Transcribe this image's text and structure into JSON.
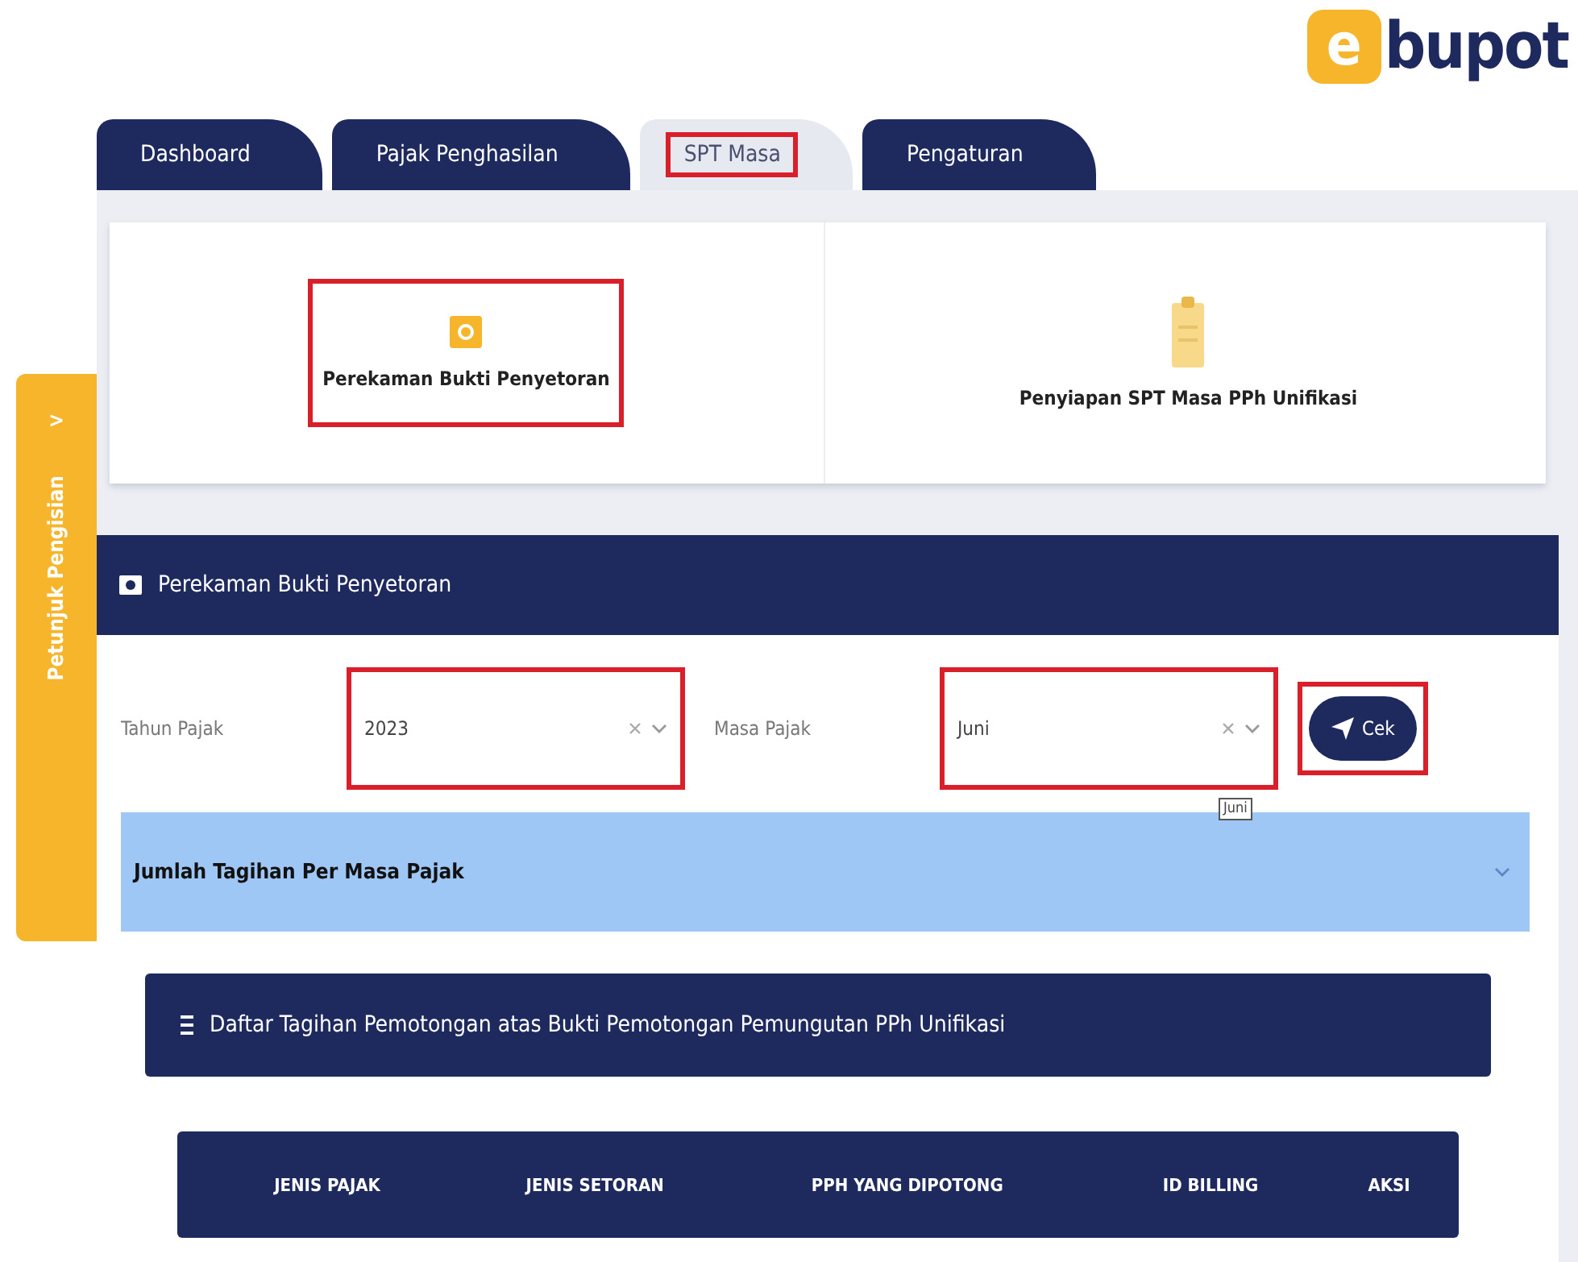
{
  "logo": {
    "letter": "e",
    "name": "bupot"
  },
  "tabs": [
    {
      "label": "Dashboard",
      "selected": false,
      "highlighted": false
    },
    {
      "label": "Pajak Penghasilan",
      "selected": false,
      "highlighted": false
    },
    {
      "label": "SPT Masa",
      "selected": true,
      "highlighted": true
    },
    {
      "label": "Pengaturan",
      "selected": false,
      "highlighted": false
    }
  ],
  "side_tab": {
    "label": "Petunjuk Pengisian",
    "arrow": ">"
  },
  "menu_cards": [
    {
      "label": "Perekaman Bukti Penyetoran",
      "kind": "box",
      "highlighted": true
    },
    {
      "label": "Penyiapan SPT Masa PPh Unifikasi",
      "kind": "clipboard",
      "highlighted": false
    }
  ],
  "section": {
    "title": "Perekaman Bukti Penyetoran"
  },
  "filters": [
    {
      "label": "Tahun Pajak",
      "value": "2023",
      "highlighted": true
    },
    {
      "label": "Masa Pajak",
      "value": "Juni",
      "highlighted": true,
      "tooltip": "Juni"
    }
  ],
  "check_button": {
    "label": "Cek",
    "highlighted": true
  },
  "accordion": {
    "title": "Jumlah Tagihan Per Masa Pajak",
    "expanded": false
  },
  "table_card": {
    "title": "Daftar Tagihan Pemotongan atas Bukti Pemotongan Pemungutan PPh Unifikasi",
    "columns": [
      "JENIS PAJAK",
      "JENIS SETORAN",
      "PPH YANG DIPOTONG",
      "ID BILLING",
      "AKSI"
    ]
  }
}
